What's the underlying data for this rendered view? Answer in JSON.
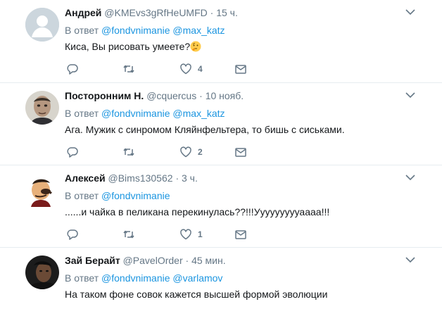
{
  "tweets": [
    {
      "name": "Андрей",
      "handle": "@KMEvs3gRfHeUMFD",
      "time": "15 ч.",
      "reply_prefix": "В ответ",
      "mentions": [
        "@fondvnimanie",
        "@max_katz"
      ],
      "text": "Киса, Вы рисовать умеете?",
      "emoji": "thinking-face-emoji",
      "likes": "4"
    },
    {
      "name": "Посторонним Н.",
      "handle": "@cquercus",
      "time": "10 нояб.",
      "reply_prefix": "В ответ",
      "mentions": [
        "@fondvnimanie",
        "@max_katz"
      ],
      "text": "Ага. Мужик с синромом Кляйнфельтера, то бишь с сиськами.",
      "likes": "2"
    },
    {
      "name": "Алексей",
      "handle": "@Bims130562",
      "time": "3 ч.",
      "reply_prefix": "В ответ",
      "mentions": [
        "@fondvnimanie"
      ],
      "text": "......и чайка в пеликана перекинулась??!!!Уууууууууаааа!!!",
      "likes": "1"
    },
    {
      "name": "Зай Берайт",
      "handle": "@PavelOrder",
      "time": "45 мин.",
      "reply_prefix": "В ответ",
      "mentions": [
        "@fondvnimanie",
        "@varlamov"
      ],
      "text": "На таком фоне совок кажется высшей формой эволюции",
      "likes": ""
    }
  ],
  "separator": "·",
  "colors": {
    "link": "#1b95e0",
    "muted": "#657786",
    "text": "#14171a",
    "divider": "#e6ecf0"
  }
}
